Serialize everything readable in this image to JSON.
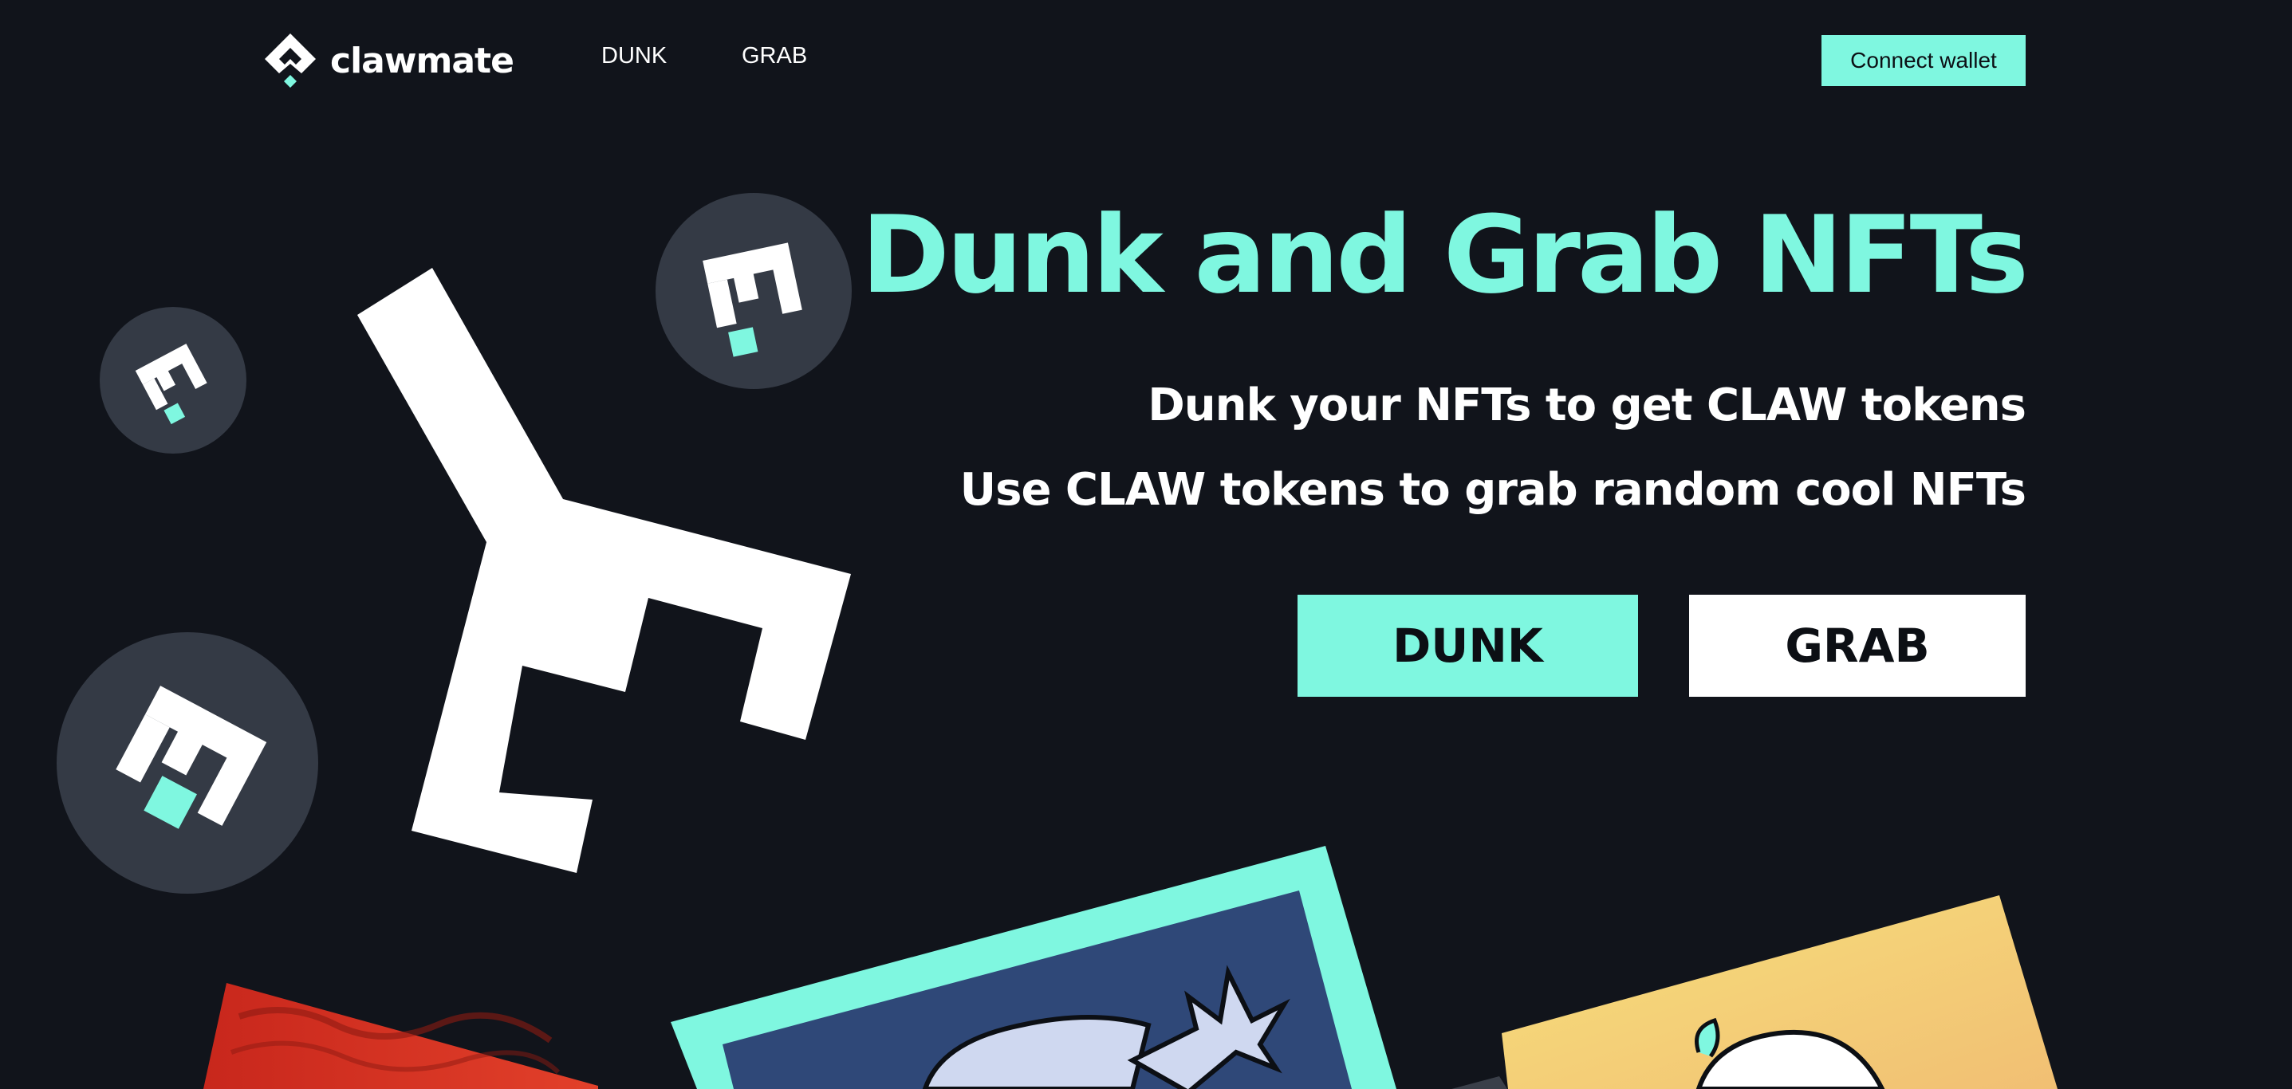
{
  "header": {
    "brand_name": "clawmate",
    "nav": {
      "dunk_label": "DUNK",
      "grab_label": "GRAB"
    },
    "connect_wallet_label": "Connect wallet"
  },
  "hero": {
    "title": "Dunk and Grab NFTs",
    "line1": "Dunk your NFTs to get CLAW tokens",
    "line2": "Use CLAW tokens to grab random cool NFTs",
    "dunk_button_label": "DUNK",
    "grab_button_label": "GRAB"
  },
  "colors": {
    "background": "#11141b",
    "accent": "#7ff7e0",
    "badge_circle": "#343a45",
    "button_text": "#0c0f14",
    "white": "#ffffff"
  },
  "icons": {
    "brand_logo": "clawmate-logo-icon",
    "badge": "claw-badge-icon",
    "big_claw": "claw-icon"
  },
  "nft_cards": [
    {
      "name": "red-nft-card"
    },
    {
      "name": "blue-nft-card"
    },
    {
      "name": "yellow-nft-card"
    }
  ]
}
